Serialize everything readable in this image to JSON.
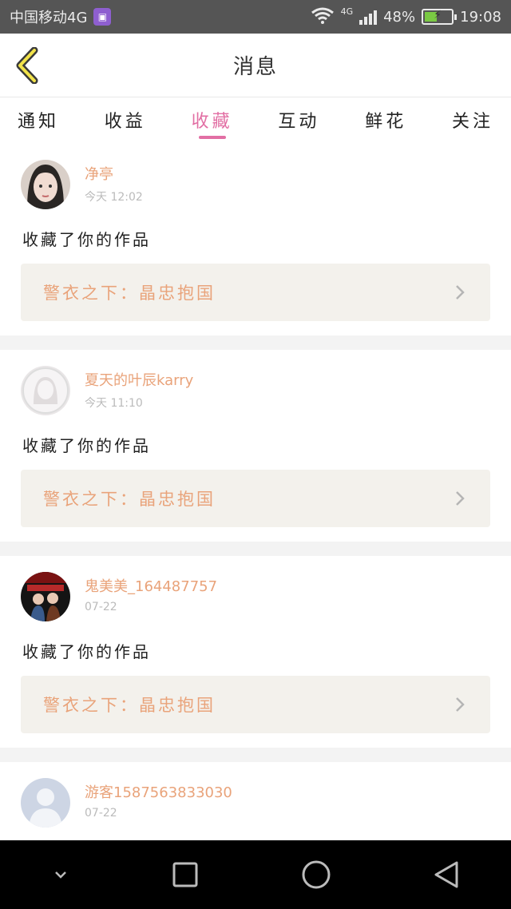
{
  "status_bar": {
    "carrier": "中国移动4G",
    "network": "4G",
    "battery": "48%",
    "time": "19:08"
  },
  "header": {
    "title": "消息"
  },
  "tabs": [
    {
      "label": "通知"
    },
    {
      "label": "收益"
    },
    {
      "label": "收藏"
    },
    {
      "label": "互动"
    },
    {
      "label": "鲜花"
    },
    {
      "label": "关注"
    }
  ],
  "active_tab": "收藏",
  "messages": [
    {
      "user": "净亭",
      "time": "今天 12:02",
      "action": "收藏了你的作品",
      "work": "警衣之下：晶忠抱国",
      "avatar": "girl-photo"
    },
    {
      "user": "夏天的叶辰karry",
      "time": "今天 11:10",
      "action": "收藏了你的作品",
      "work": "警衣之下：晶忠抱国",
      "avatar": "default-female"
    },
    {
      "user": "鬼美美_164487757",
      "time": "07-22",
      "action": "收藏了你的作品",
      "work": "警衣之下：晶忠抱国",
      "avatar": "drama-photo"
    },
    {
      "user": "游客1587563833030",
      "time": "07-22",
      "action": "",
      "work": "",
      "avatar": "default-guest"
    }
  ],
  "colors": {
    "accent": "#e26fa4",
    "name": "#e9a37a",
    "status_bar": "#555555",
    "nav_bar": "#000000",
    "card_link_bg": "#f3f1ec"
  },
  "icons": {
    "back": "back-chevron-icon",
    "wifi": "wifi-icon",
    "signal": "signal-icon",
    "battery": "battery-icon",
    "chevron": "chevron-right-icon",
    "nav_down": "chevron-down-icon",
    "nav_recent": "square-icon",
    "nav_home": "circle-icon",
    "nav_back": "triangle-back-icon"
  }
}
